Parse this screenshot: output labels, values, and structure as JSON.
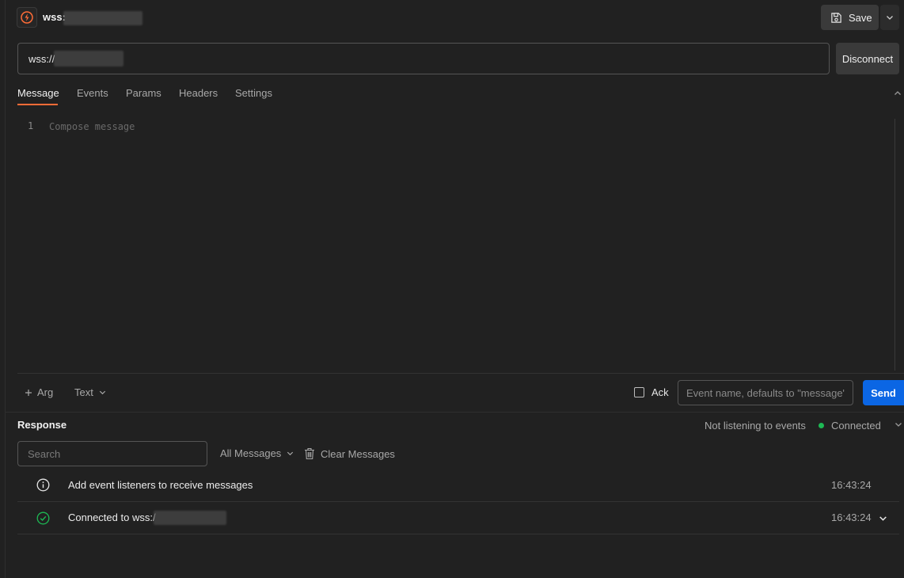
{
  "header": {
    "title": "wss:",
    "save_label": "Save"
  },
  "url": {
    "value": "wss://",
    "disconnect_label": "Disconnect"
  },
  "tabs": [
    {
      "label": "Message",
      "active": true
    },
    {
      "label": "Events"
    },
    {
      "label": "Params"
    },
    {
      "label": "Headers"
    },
    {
      "label": "Settings"
    }
  ],
  "editor": {
    "line_number": "1",
    "placeholder": "Compose message"
  },
  "toolbar": {
    "arg_label": "Arg",
    "format_label": "Text",
    "ack_label": "Ack",
    "event_placeholder": "Event name, defaults to \"message\"",
    "send_label": "Send"
  },
  "response": {
    "title": "Response",
    "listening_status": "Not listening to events",
    "connection_status": "Connected",
    "search_placeholder": "Search",
    "filter_label": "All Messages",
    "clear_label": "Clear Messages",
    "messages": [
      {
        "icon": "info-icon",
        "text": "Add event listeners to receive messages",
        "time": "16:43:24"
      },
      {
        "icon": "check-circle-icon",
        "text": "Connected to wss:/",
        "time": "16:43:24"
      }
    ]
  },
  "colors": {
    "accent": "#ff6c37",
    "send": "#0b66e4",
    "connected": "#1db954"
  }
}
